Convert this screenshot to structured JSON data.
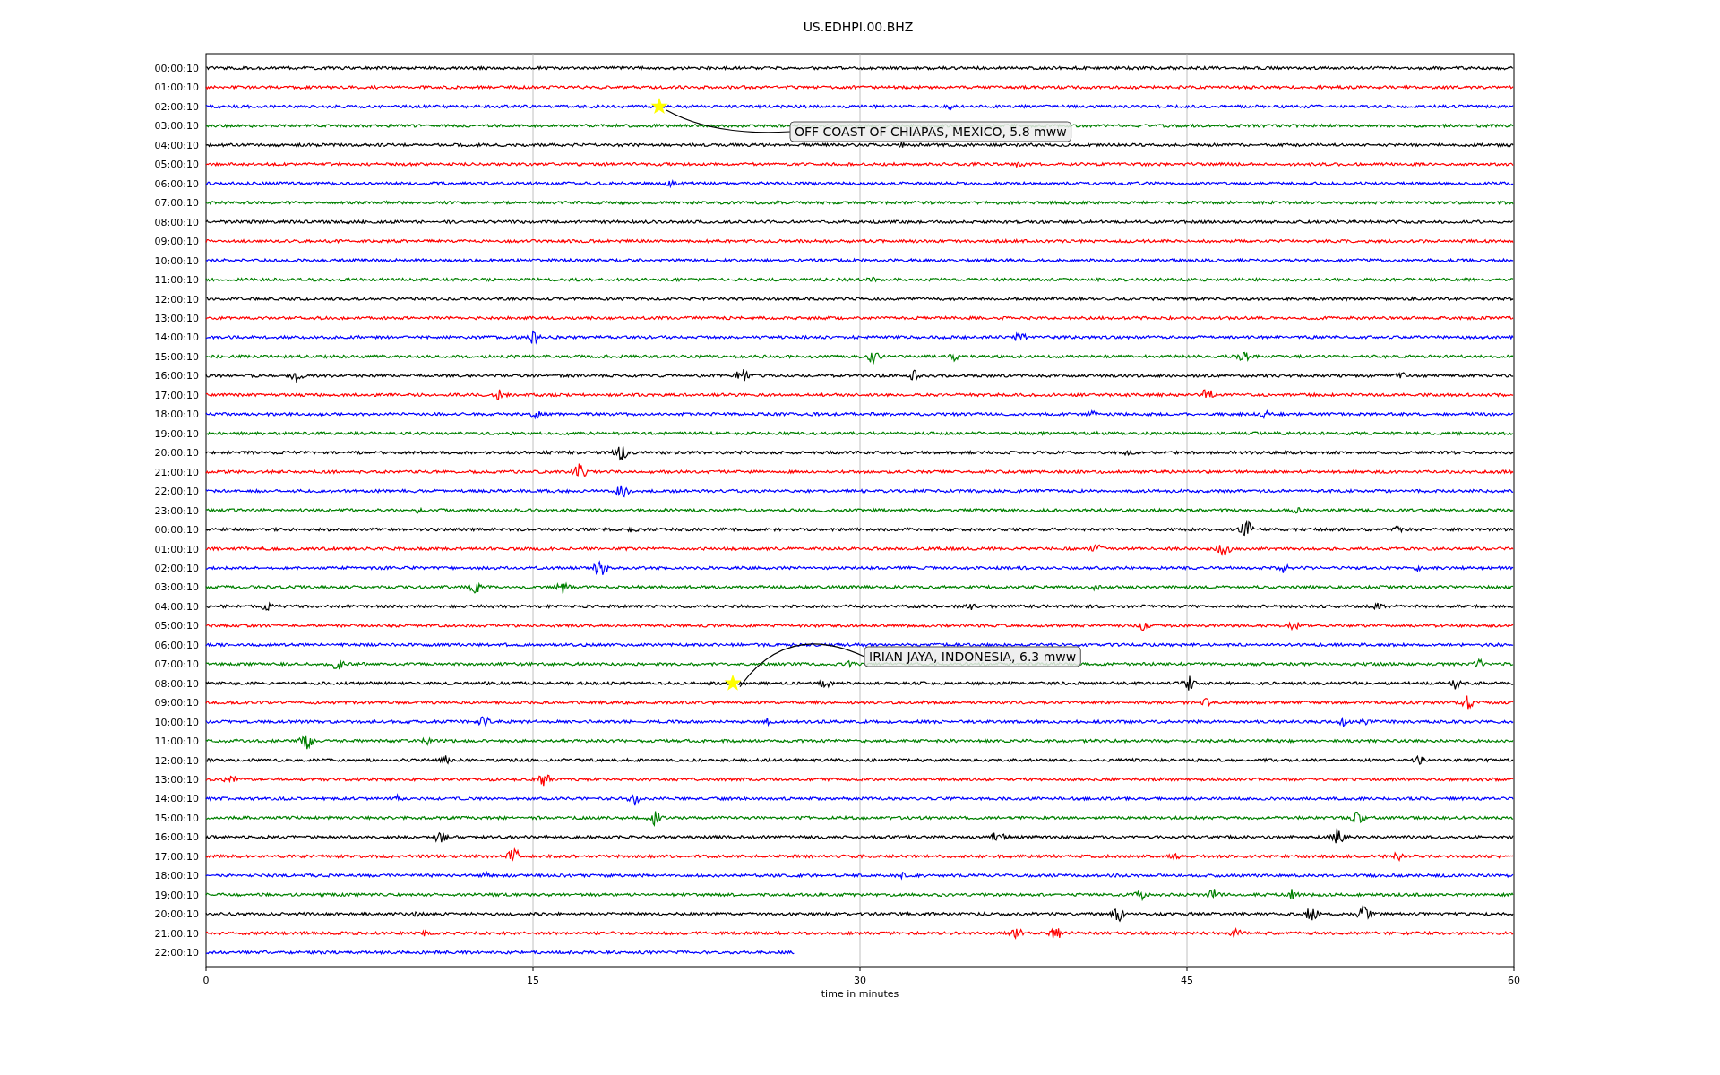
{
  "title": "US.EDHPI.00.BHZ",
  "traces": [
    {
      "label": "00:00:10",
      "color": "#000000",
      "level": 1
    },
    {
      "label": "01:00:10",
      "color": "#ff0000",
      "level": 1
    },
    {
      "label": "02:00:10",
      "color": "#0000ff",
      "level": 1,
      "event": "OFF COAST OF CHIAPAS, MEXICO, 5.8 mww"
    },
    {
      "label": "03:00:10",
      "color": "#008000",
      "level": 1
    },
    {
      "label": "04:00:10",
      "color": "#000000",
      "level": 1
    },
    {
      "label": "05:00:10",
      "color": "#ff0000",
      "level": 1
    },
    {
      "label": "06:00:10",
      "color": "#0000ff",
      "level": 1
    },
    {
      "label": "07:00:10",
      "color": "#008000",
      "level": 1
    },
    {
      "label": "08:00:10",
      "color": "#000000",
      "level": 1
    },
    {
      "label": "09:00:10",
      "color": "#ff0000",
      "level": 1
    },
    {
      "label": "10:00:10",
      "color": "#0000ff",
      "level": 1
    },
    {
      "label": "11:00:10",
      "color": "#008000",
      "level": 1
    },
    {
      "label": "12:00:10",
      "color": "#000000",
      "level": 1
    },
    {
      "label": "13:00:10",
      "color": "#ff0000",
      "level": 1
    },
    {
      "label": "14:00:10",
      "color": "#0000ff",
      "level": 1
    },
    {
      "label": "15:00:10",
      "color": "#008000",
      "level": 1
    },
    {
      "label": "16:00:10",
      "color": "#000000",
      "level": 1
    },
    {
      "label": "17:00:10",
      "color": "#ff0000",
      "level": 1
    },
    {
      "label": "18:00:10",
      "color": "#0000ff",
      "level": 1
    },
    {
      "label": "19:00:10",
      "color": "#008000",
      "level": 1
    },
    {
      "label": "20:00:10",
      "color": "#000000",
      "level": 1
    },
    {
      "label": "21:00:10",
      "color": "#ff0000",
      "level": 1
    },
    {
      "label": "22:00:10",
      "color": "#0000ff",
      "level": 1
    },
    {
      "label": "23:00:10",
      "color": "#008000",
      "level": 1
    },
    {
      "label": "00:00:10",
      "color": "#000000",
      "level": 1
    },
    {
      "label": "01:00:10",
      "color": "#ff0000",
      "level": 1
    },
    {
      "label": "02:00:10",
      "color": "#0000ff",
      "level": 1
    },
    {
      "label": "03:00:10",
      "color": "#008000",
      "level": 1
    },
    {
      "label": "04:00:10",
      "color": "#000000",
      "level": 1
    },
    {
      "label": "05:00:10",
      "color": "#ff0000",
      "level": 1
    },
    {
      "label": "06:00:10",
      "color": "#0000ff",
      "level": 1
    },
    {
      "label": "07:00:10",
      "color": "#008000",
      "level": 1
    },
    {
      "label": "08:00:10",
      "color": "#000000",
      "level": 1,
      "event": "IRIAN JAYA, INDONESIA, 6.3 mww"
    },
    {
      "label": "09:00:10",
      "color": "#ff0000",
      "level": 1
    },
    {
      "label": "10:00:10",
      "color": "#0000ff",
      "level": 1
    },
    {
      "label": "11:00:10",
      "color": "#008000",
      "level": 1
    },
    {
      "label": "12:00:10",
      "color": "#000000",
      "level": 1
    },
    {
      "label": "13:00:10",
      "color": "#ff0000",
      "level": 1
    },
    {
      "label": "14:00:10",
      "color": "#0000ff",
      "level": 1
    },
    {
      "label": "15:00:10",
      "color": "#008000",
      "level": 1
    },
    {
      "label": "16:00:10",
      "color": "#000000",
      "level": 1
    },
    {
      "label": "17:00:10",
      "color": "#ff0000",
      "level": 1
    },
    {
      "label": "18:00:10",
      "color": "#0000ff",
      "level": 1
    },
    {
      "label": "19:00:10",
      "color": "#008000",
      "level": 1
    },
    {
      "label": "20:00:10",
      "color": "#000000",
      "level": 1
    },
    {
      "label": "21:00:10",
      "color": "#ff0000",
      "level": 1
    },
    {
      "label": "22:00:10",
      "color": "#0000ff",
      "level": 0.45
    }
  ],
  "x_axis": {
    "ticks": [
      "0",
      "15",
      "30",
      "45",
      "60"
    ],
    "label": "time in minutes"
  }
}
